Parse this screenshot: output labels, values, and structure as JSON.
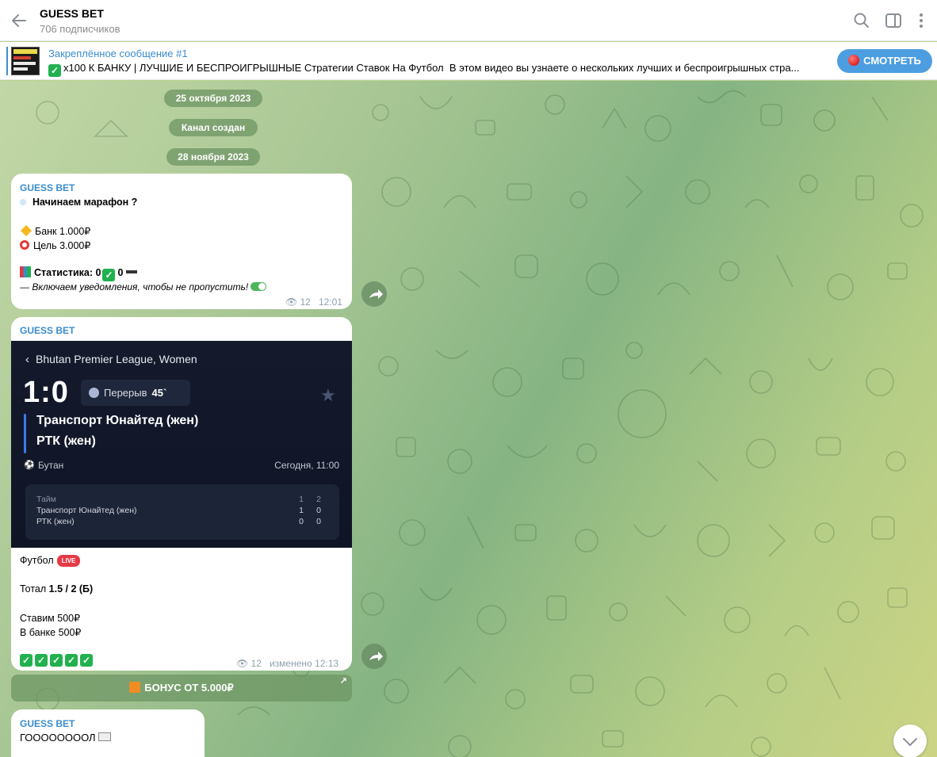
{
  "header": {
    "title": "GUESS BET",
    "subtitle": "706 подписчиков"
  },
  "pinned": {
    "title": "Закреплённое сообщение #1",
    "text_bold": "х100 К БАНКУ | ЛУЧШИЕ И БЕСПРОИГРЫШНЫЕ Стратегии Ставок На Футбол",
    "text_rest": "В этом видео вы узнаете о нескольких лучших и беспроигрышных стра...",
    "button": "СМОТРЕТЬ"
  },
  "dates": [
    "25 октября 2023",
    "Канал создан",
    "28 ноября 2023"
  ],
  "msg1": {
    "sender": "GUESS BET",
    "line1": "Начинаем марафон ?",
    "line2": "Банк 1.000₽",
    "line3": "Цель 3.000₽",
    "line4_label": "Статистика: 0",
    "line4_end": "0",
    "line5": "— Включаем уведомления, чтобы не пропустить!",
    "views": "12",
    "time": "12:01"
  },
  "msg2": {
    "sender": "GUESS BET",
    "card": {
      "league": "Bhutan Premier League, Women",
      "score": "1:0",
      "period_label": "Перерыв",
      "period_min": "45`",
      "team1": "Транспорт Юнайтед (жен)",
      "team2": "РТК (жен)",
      "country": "Бутан",
      "time": "Сегодня, 11:00",
      "table_header": "Тайм",
      "h1": "1",
      "h2": "2",
      "row1_name": "Транспорт Юнайтед (жен)",
      "row1_a": "1",
      "row1_b": "0",
      "row2_name": "РТК (жен)",
      "row2_a": "0",
      "row2_b": "0"
    },
    "sport": "Футбол",
    "live": "LIVE",
    "total_label": "Тотал",
    "total_value": "1.5 / 2 (Б)",
    "bet": "Ставим 500₽",
    "bank": "В банке 500₽",
    "views": "12",
    "edited": "изменено 12:13",
    "button": "БОНУС ОТ 5.000₽"
  },
  "msg3": {
    "sender": "GUESS BET",
    "text": "ГООООООООЛ"
  }
}
